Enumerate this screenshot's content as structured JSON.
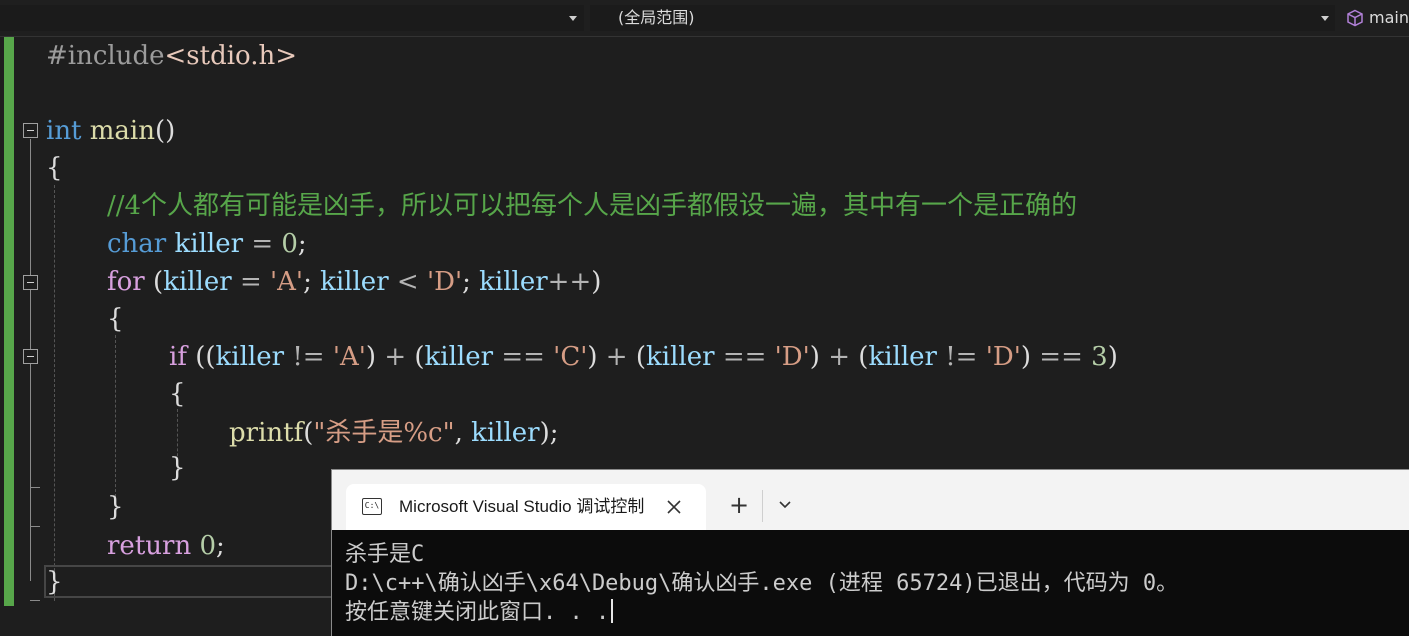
{
  "navbar": {
    "file_dropdown": "",
    "scope": "(全局范围)",
    "function": "main",
    "function_icon": "cube-icon"
  },
  "code": {
    "line1": {
      "pp": "#include",
      "header": "<stdio.h>"
    },
    "line2": {
      "kw": "int",
      "fn": "main",
      "punct": "()"
    },
    "line3": {
      "brace": "{"
    },
    "line4": {
      "comment": "//4个人都有可能是凶手，所以可以把每个人是凶手都假设一遍，其中有一个是正确的"
    },
    "line5": {
      "kw": "char",
      "var": "killer",
      "eq": "=",
      "num": "0",
      "semi": ";"
    },
    "line6": {
      "kw": "for",
      "open": "(",
      "var1": "killer",
      "eq": "=",
      "str1": "'A'",
      "semi1": ";",
      "var2": "killer",
      "lt": "<",
      "str2": "'D'",
      "semi2": ";",
      "var3": "killer",
      "inc": "++",
      "close": ")"
    },
    "line7": {
      "brace": "{"
    },
    "line8": {
      "kw": "if",
      "open": "((",
      "var1": "killer",
      "op1": "!=",
      "str1": "'A'",
      "close1": ")",
      "plus1": "+",
      "open2": "(",
      "var2": "killer",
      "op2": "==",
      "str2": "'C'",
      "close2": ")",
      "plus2": "+",
      "open3": "(",
      "var3": "killer",
      "op3": "==",
      "str3": "'D'",
      "close3": ")",
      "plus3": "+",
      "open4": "(",
      "var4": "killer",
      "op4": "!=",
      "str4": "'D'",
      "close4": ")",
      "eqeq": "==",
      "num": "3",
      "close5": ")"
    },
    "line9": {
      "brace": "{"
    },
    "line10": {
      "fn": "printf",
      "open": "(",
      "str": "\"杀手是%c\"",
      "comma": ",",
      "var": "killer",
      "close": ");"
    },
    "line11": {
      "brace": "}"
    },
    "line12": {
      "brace": "}"
    },
    "line13": {
      "kw": "return",
      "num": "0",
      "semi": ";"
    },
    "line14": {
      "brace": "}"
    }
  },
  "console": {
    "tab_title": "Microsoft Visual Studio 调试控制台",
    "tab_icon": "C:\\",
    "new_tab": "+",
    "output_line1": "杀手是C",
    "output_line2": "D:\\c++\\确认凶手\\x64\\Debug\\确认凶手.exe (进程 65724)已退出，代码为 0。",
    "output_line3": "按任意键关闭此窗口. . ."
  },
  "colors": {
    "editor_bg": "#1e1e1e",
    "keyword": "#569cd6",
    "control_keyword": "#d8a0df",
    "function": "#dcdcaa",
    "variable": "#9cdcfe",
    "number": "#b5cea8",
    "string": "#d69d85",
    "comment": "#57a64a",
    "change_bar": "#57a64a",
    "console_bg": "#0c0c0c"
  }
}
